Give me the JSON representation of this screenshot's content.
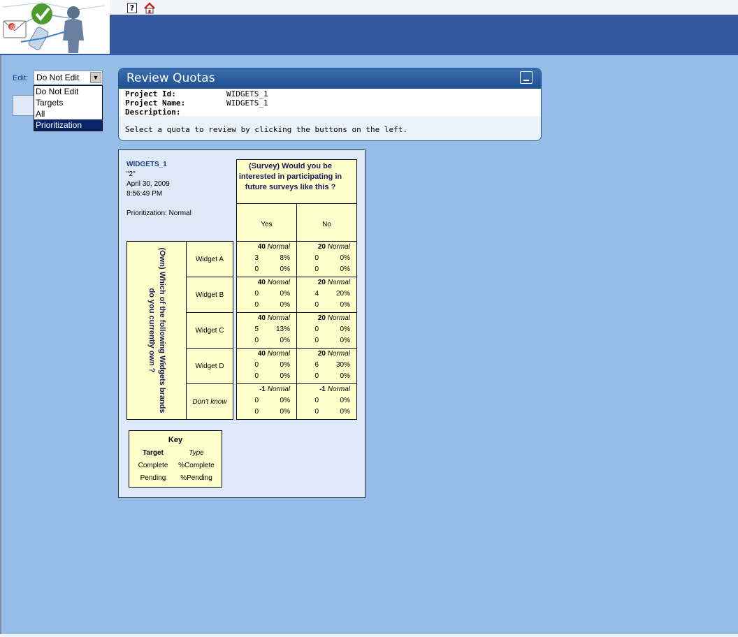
{
  "header": {
    "help_label": "?"
  },
  "edit": {
    "label": "Edit:",
    "selected": "Do Not Edit",
    "options": [
      "Do Not Edit",
      "Targets",
      "All",
      "Prioritization"
    ],
    "highlighted_option": "Prioritization"
  },
  "panel": {
    "title": "Review Quotas",
    "rows": [
      {
        "label": "Project Id:",
        "value": "WIDGETS_1"
      },
      {
        "label": "Project Name:",
        "value": "WIDGETS_1"
      },
      {
        "label": "Description:",
        "value": ""
      }
    ],
    "note": "Select a quota to review by clicking the buttons on the left."
  },
  "quota": {
    "project": "WIDGETS_1",
    "quota_id": "\"2\"",
    "date": "April 30, 2009",
    "time": "8:56:49 PM",
    "prioritization": "Prioritization: Normal",
    "column_question": "(Survey) Would you be interested in participating in future surveys like this ?",
    "columns": [
      "Yes",
      "No"
    ],
    "row_question": "(Own) Which of the following Widgets brands do you currently own ?",
    "rows": [
      {
        "label": "Widget A",
        "cells": [
          {
            "target": "40",
            "type": "Normal",
            "complete": "3",
            "pct_complete": "8%",
            "pending": "0",
            "pct_pending": "0%"
          },
          {
            "target": "20",
            "type": "Normal",
            "complete": "0",
            "pct_complete": "0%",
            "pending": "0",
            "pct_pending": "0%"
          }
        ]
      },
      {
        "label": "Widget B",
        "cells": [
          {
            "target": "40",
            "type": "Normal",
            "complete": "0",
            "pct_complete": "0%",
            "pending": "0",
            "pct_pending": "0%"
          },
          {
            "target": "20",
            "type": "Normal",
            "complete": "4",
            "pct_complete": "20%",
            "pending": "0",
            "pct_pending": "0%"
          }
        ]
      },
      {
        "label": "Widget C",
        "cells": [
          {
            "target": "40",
            "type": "Normal",
            "complete": "5",
            "pct_complete": "13%",
            "pending": "0",
            "pct_pending": "0%"
          },
          {
            "target": "20",
            "type": "Normal",
            "complete": "0",
            "pct_complete": "0%",
            "pending": "0",
            "pct_pending": "0%"
          }
        ]
      },
      {
        "label": "Widget D",
        "cells": [
          {
            "target": "40",
            "type": "Normal",
            "complete": "0",
            "pct_complete": "0%",
            "pending": "0",
            "pct_pending": "0%"
          },
          {
            "target": "20",
            "type": "Normal",
            "complete": "6",
            "pct_complete": "30%",
            "pending": "0",
            "pct_pending": "0%"
          }
        ]
      },
      {
        "label": "Don't know",
        "cells": [
          {
            "target": "-1",
            "type": "Normal",
            "complete": "0",
            "pct_complete": "0%",
            "pending": "0",
            "pct_pending": "0%"
          },
          {
            "target": "-1",
            "type": "Normal",
            "complete": "0",
            "pct_complete": "0%",
            "pending": "0",
            "pct_pending": "0%"
          }
        ]
      }
    ]
  },
  "key": {
    "title": "Key",
    "target": "Target",
    "type": "Type",
    "complete": "Complete",
    "pct_complete": "%Complete",
    "pending": "Pending",
    "pct_pending": "%Pending"
  }
}
